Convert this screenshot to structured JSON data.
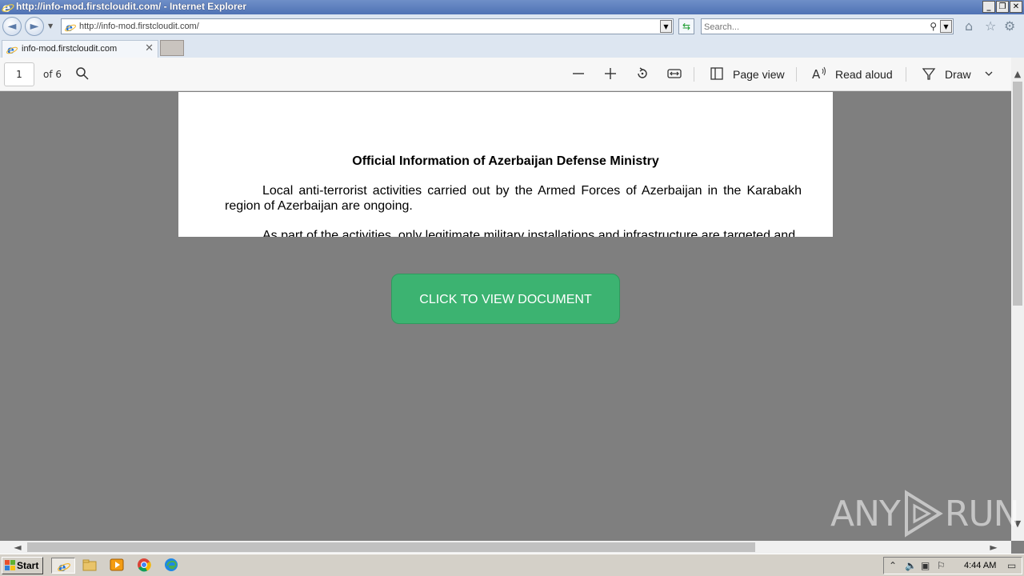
{
  "window": {
    "title": "http://info-mod.firstcloudit.com/ - Internet Explorer",
    "controls": {
      "minimize": "_",
      "restore": "❐",
      "close": "✕"
    }
  },
  "navbar": {
    "back_icon": "back-arrow-icon",
    "forward_icon": "forward-arrow-icon",
    "address_url": "http://info-mod.firstcloudit.com/",
    "search_placeholder": "Search...",
    "toolbar_icons": [
      "home-icon",
      "favorites-star-icon",
      "settings-gear-icon"
    ]
  },
  "tab": {
    "label": "info-mod.firstcloudit.com",
    "close": "✕"
  },
  "pdf_toolbar": {
    "current_page": "1",
    "page_count_text": "of 6",
    "page_view_label": "Page view",
    "read_aloud_label": "Read aloud",
    "draw_label": "Draw"
  },
  "document": {
    "title": "Official Information of Azerbaijan Defense Ministry",
    "paragraph1": "Local anti-terrorist activities carried out by the Armed Forces of Azerbaijan in the Karabakh region of Azerbaijan are ongoing.",
    "paragraph2": "As part of the activities, only legitimate military installations and infrastructure are targeted and"
  },
  "cta": {
    "label": "CLICK TO VIEW DOCUMENT",
    "color": "#3cb371"
  },
  "watermark": {
    "text_left": "ANY",
    "text_right": "RUN"
  },
  "taskbar": {
    "start_label": "Start",
    "apps": [
      "internet-explorer-icon",
      "file-explorer-icon",
      "media-player-icon",
      "chrome-icon",
      "edge-icon"
    ],
    "clock": "4:44 AM"
  }
}
